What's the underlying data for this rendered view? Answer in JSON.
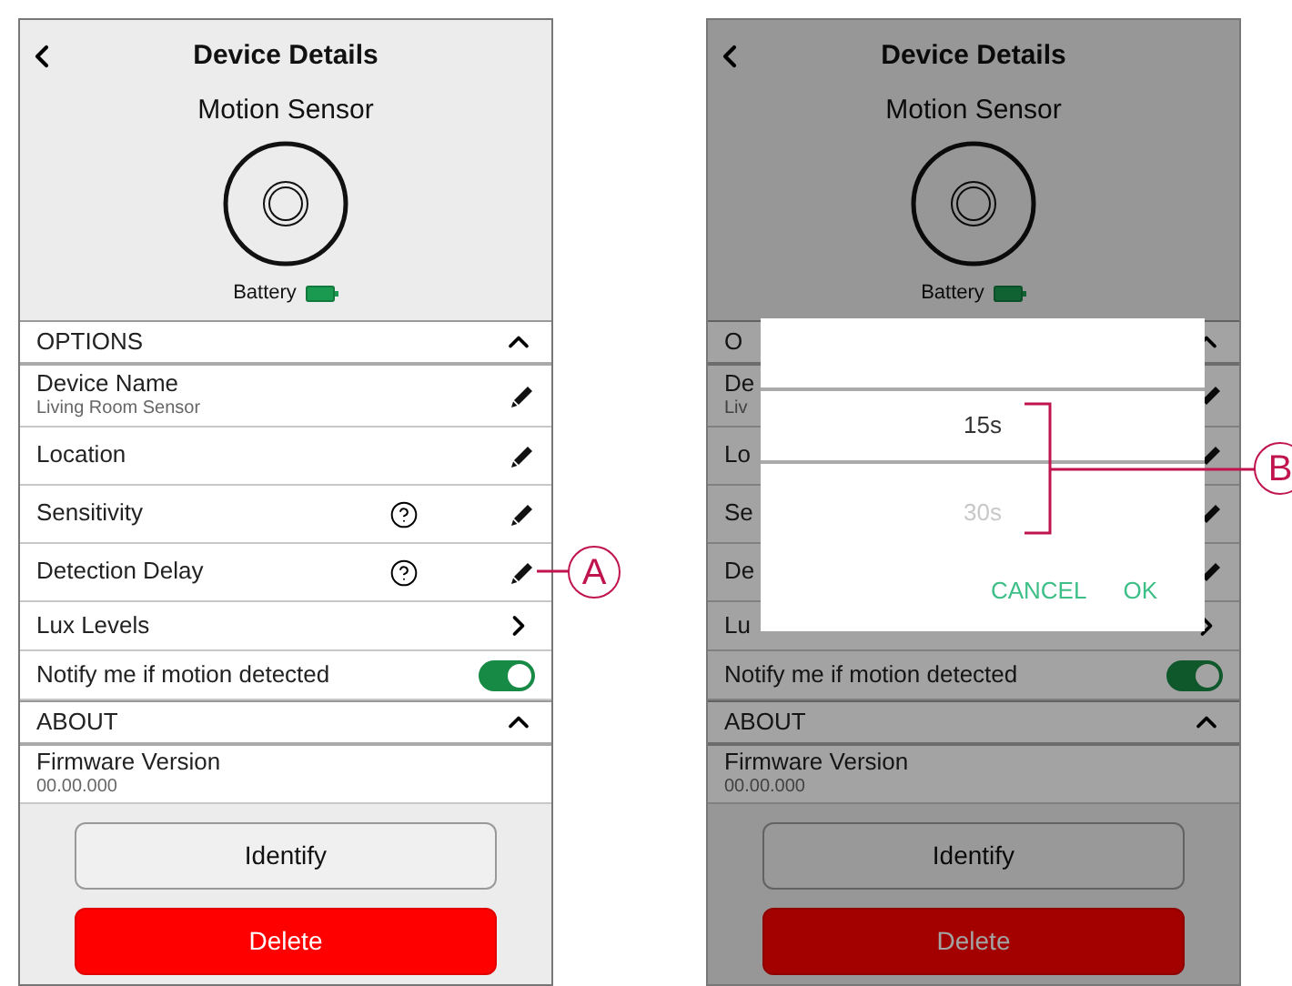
{
  "screens": [
    {
      "title": "Device Details",
      "device": "Motion Sensor",
      "battery": "Battery",
      "sections": [
        {
          "label": "OPTIONS",
          "expanded": true,
          "rows": [
            {
              "kind": "edit",
              "label": "Device Name",
              "subtitle": "Living Room Sensor",
              "help": false
            },
            {
              "kind": "edit",
              "label": "Location",
              "help": false
            },
            {
              "kind": "edit",
              "label": "Sensitivity",
              "help": true
            },
            {
              "kind": "edit",
              "label": "Detection Delay",
              "help": true
            },
            {
              "kind": "link",
              "label": "Lux Levels"
            },
            {
              "kind": "toggle",
              "label": "Notify me if motion detected",
              "on": true
            }
          ]
        },
        {
          "label": "ABOUT",
          "expanded": true,
          "rows": [
            {
              "kind": "info",
              "label": "Firmware Version",
              "subtitle": "00.00.000"
            }
          ]
        }
      ],
      "buttons": [
        {
          "kind": "secondary",
          "label": "Identify"
        },
        {
          "kind": "danger",
          "label": "Delete"
        }
      ]
    },
    {
      "title": "Device Details",
      "device": "Motion Sensor",
      "battery": "Battery",
      "sections": [
        {
          "label": "O",
          "expanded": true,
          "rows": [
            {
              "kind": "edit",
              "label": "De",
              "subtitle": "Liv",
              "help": false
            },
            {
              "kind": "edit",
              "label": "Lo",
              "help": false
            },
            {
              "kind": "edit",
              "label": "Se",
              "help": false
            },
            {
              "kind": "edit",
              "label": "De",
              "help": false
            },
            {
              "kind": "link",
              "label": "Lu"
            },
            {
              "kind": "toggle",
              "label": "Notify me if motion detected",
              "on": true
            }
          ]
        },
        {
          "label": "ABOUT",
          "expanded": true,
          "rows": [
            {
              "kind": "info",
              "label": "Firmware Version",
              "subtitle": "00.00.000"
            }
          ]
        }
      ],
      "buttons": [
        {
          "kind": "secondary",
          "label": "Identify"
        },
        {
          "kind": "danger",
          "label": "Delete"
        }
      ],
      "dialog": {
        "options": [
          {
            "label": "15s",
            "selected": true
          },
          {
            "label": "30s",
            "selected": false
          }
        ],
        "actions": [
          "CANCEL",
          "OK"
        ]
      }
    }
  ],
  "callouts": [
    {
      "label": "A"
    },
    {
      "label": "B"
    }
  ]
}
